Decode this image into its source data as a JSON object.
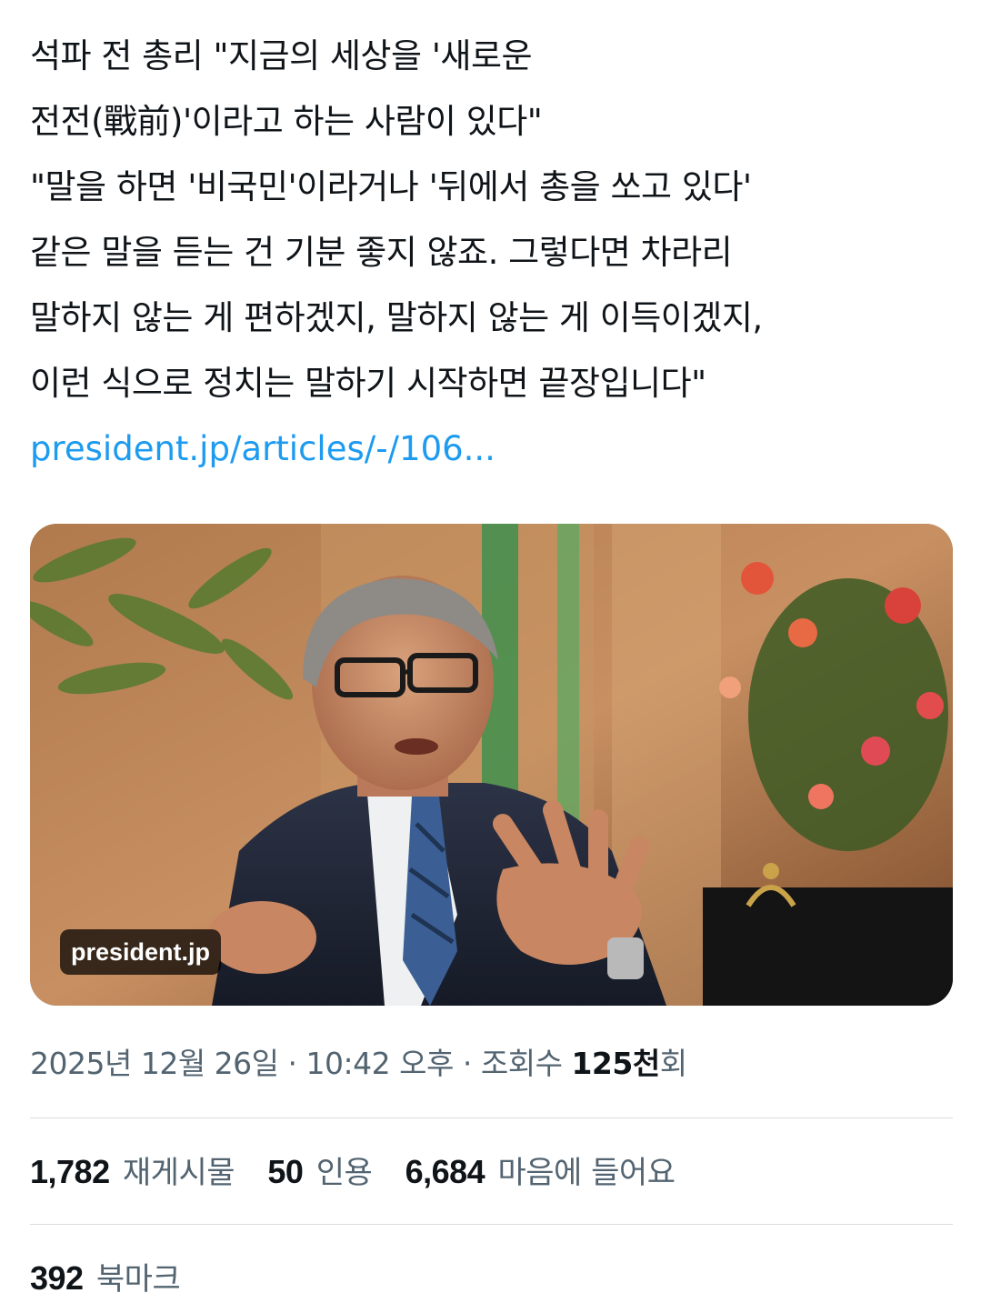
{
  "tweet": {
    "text_lines": [
      "석파 전 총리 \"지금의 세상을 '새로운",
      "전전(戰前)'이라고 하는 사람이 있다\"",
      "\"말을 하면 '비국민'이라거나 '뒤에서 총을 쏘고 있다'",
      "같은 말을 듣는 건 기분 좋지 않죠. 그렇다면 차라리",
      "말하지 않는 게 편하겠지, 말하지 않는 게 이득이겠지,",
      "이런 식으로 정치는 말하기 시작하면 끝장입니다\""
    ],
    "link_text": "president.jp/articles/-/106..."
  },
  "media": {
    "source_badge": "president.jp",
    "description_icon": "photo-thumbnail"
  },
  "meta": {
    "date": "2025년 12월 26일",
    "separator": "·",
    "time": "10:42 오후",
    "views_label": "조회수",
    "views_count": "125천",
    "views_suffix": "회"
  },
  "stats": {
    "retweets": {
      "count": "1,782",
      "label": "재게시물"
    },
    "quotes": {
      "count": "50",
      "label": "인용"
    },
    "likes": {
      "count": "6,684",
      "label": "마음에 들어요"
    },
    "bookmarks": {
      "count": "392",
      "label": "북마크"
    }
  },
  "colors": {
    "text": "#0f1419",
    "secondary": "#536471",
    "link": "#1d9bf0",
    "divider": "#d9dde1"
  }
}
